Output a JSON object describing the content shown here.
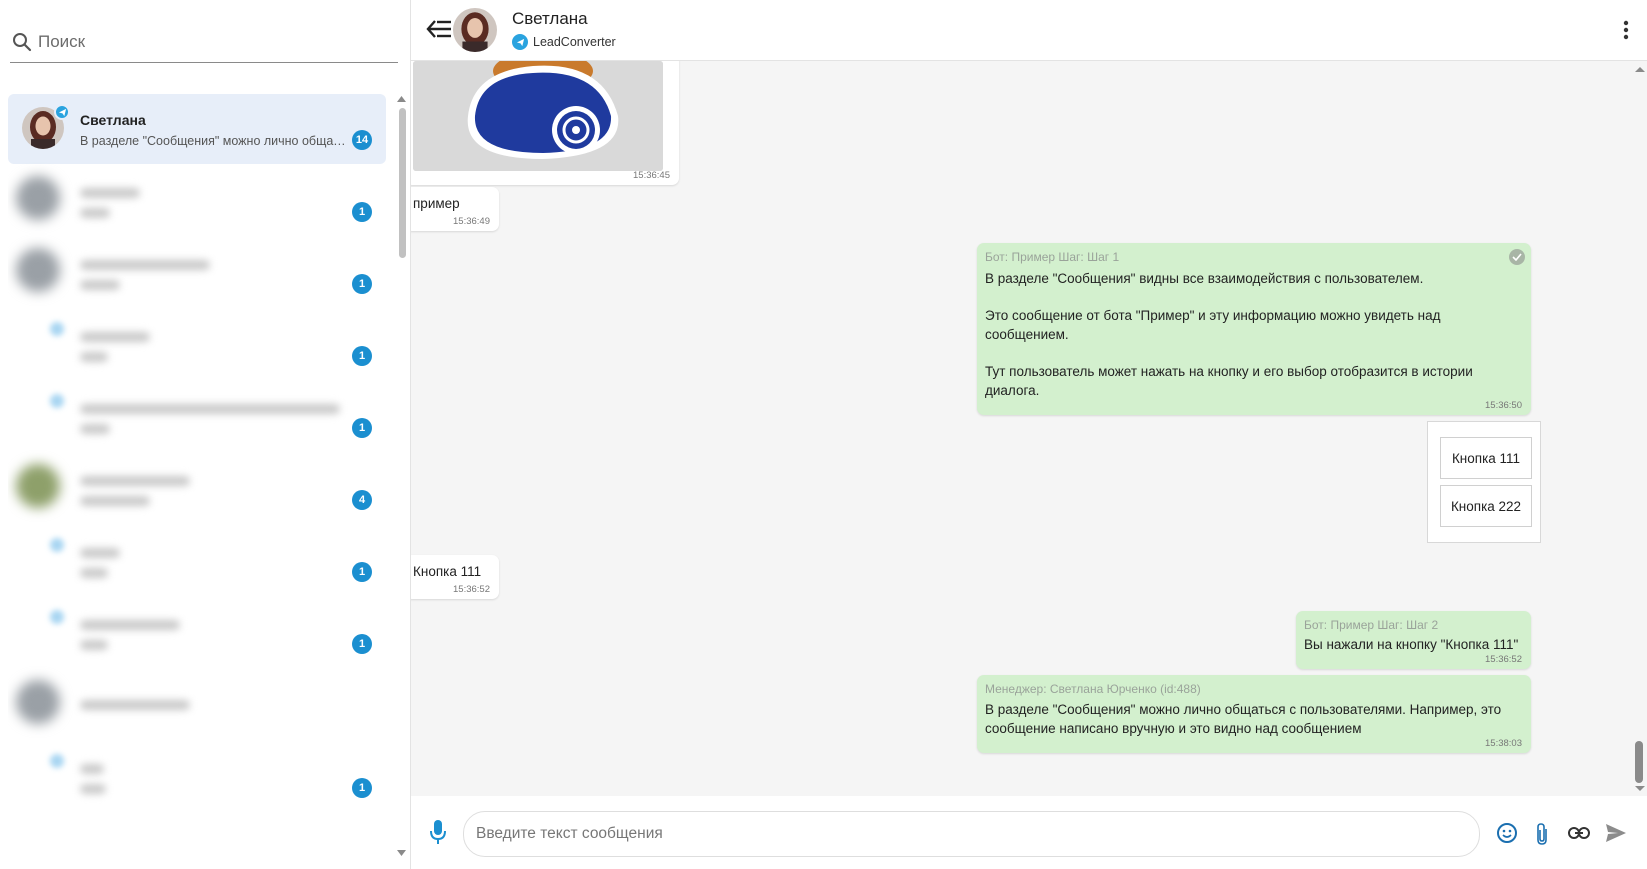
{
  "search": {
    "placeholder": "Поиск",
    "icon": "search-icon"
  },
  "chats": {
    "active": {
      "name": "Светлана",
      "preview": "В разделе \"Сообщения\" можно лично общать...",
      "unread": "14",
      "channel": "telegram-icon"
    },
    "others": [
      {
        "unread": "1"
      },
      {
        "unread": "1"
      },
      {
        "unread": "1"
      },
      {
        "unread": "1"
      },
      {
        "unread": "4"
      },
      {
        "unread": "1"
      },
      {
        "unread": "1"
      },
      {
        "unread": ""
      },
      {
        "unread": "1"
      }
    ]
  },
  "header": {
    "name": "Светлана",
    "source": "LeadConverter",
    "back_icon": "arrow-back-icon",
    "menu_icon": "more-vert-icon"
  },
  "messages": {
    "sticker_time": "15:36:45",
    "m1": {
      "text": "пример",
      "time": "15:36:49"
    },
    "m2": {
      "meta": "Бот: Пример Шаг: Шаг 1",
      "line1": "В разделе \"Сообщения\" видны все взаимодействия с пользователем.",
      "line2": "Это сообщение от бота \"Пример\" и эту информацию можно увидеть над сообщением.",
      "line3": "Тут пользователь может нажать на кнопку и его выбор отобразится в истории диалога.",
      "time": "15:36:50"
    },
    "buttons": [
      "Кнопка 111",
      "Кнопка 222"
    ],
    "m3": {
      "text": "Кнопка 111",
      "time": "15:36:52"
    },
    "m4": {
      "meta": "Бот: Пример Шаг: Шаг 2",
      "text": "Вы нажали на кнопку \"Кнопка 111\"",
      "time": "15:36:52"
    },
    "m5": {
      "meta": "Менеджер: Светлана Юрченко (id:488)",
      "text": "В разделе \"Сообщения\" можно лично общаться с пользователями. Например, это сообщение написано вручную и это видно над сообщением",
      "time": "15:38:03"
    }
  },
  "composer": {
    "placeholder": "Введите текст сообщения",
    "icons": [
      "microphone-icon",
      "emoji-icon",
      "attach-icon",
      "link-icon",
      "send-icon"
    ]
  },
  "colors": {
    "accent": "#1b8fd0",
    "out_bubble": "#d3f0ce",
    "active_chat": "#e7eef9",
    "telegram": "#2aa3df"
  }
}
